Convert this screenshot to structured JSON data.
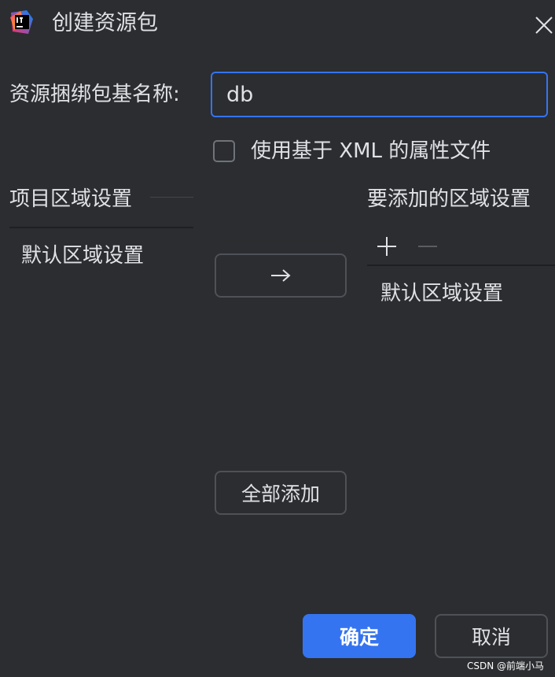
{
  "window": {
    "title": "创建资源包",
    "app_icon": "intellij-idea-icon",
    "close_icon": "close-icon"
  },
  "form": {
    "base_name_label": "资源捆绑包基名称:",
    "base_name_value": "db",
    "use_xml_label": "使用基于 XML 的属性文件",
    "use_xml_checked": false
  },
  "left_panel": {
    "title": "项目区域设置",
    "items": [
      "默认区域设置"
    ]
  },
  "right_panel": {
    "title": "要添加的区域设置",
    "add_icon": "plus-icon",
    "remove_icon": "minus-icon",
    "items": [
      "默认区域设置"
    ]
  },
  "buttons": {
    "move_right": "→",
    "add_all": "全部添加",
    "ok": "确定",
    "cancel": "取消"
  },
  "watermark": "CSDN @前端小马",
  "colors": {
    "background": "#2b2d30",
    "accent": "#3574f0",
    "text": "#dfe1e5",
    "border": "#4e5157"
  }
}
